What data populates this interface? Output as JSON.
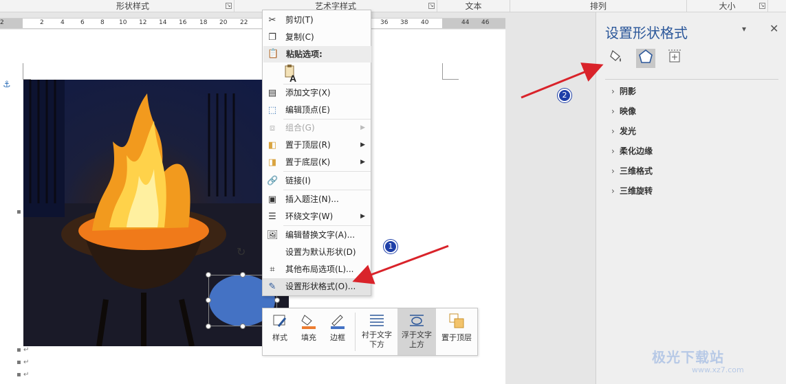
{
  "ribbon": {
    "groups": [
      {
        "label": "形状样式"
      },
      {
        "label": "艺术字样式"
      },
      {
        "label": "文本"
      },
      {
        "label": "排列"
      },
      {
        "label": "大小"
      }
    ]
  },
  "ruler": {
    "ticks": [
      "2",
      "2",
      "4",
      "6",
      "8",
      "10",
      "12",
      "14",
      "16",
      "18",
      "20",
      "22",
      "36",
      "38",
      "40",
      "44",
      "46"
    ]
  },
  "context_menu": {
    "items": [
      {
        "label": "剪切(T)",
        "icon": "scissors-icon"
      },
      {
        "label": "复制(C)",
        "icon": "copy-icon"
      },
      {
        "label": "粘贴选项:",
        "icon": "paste-icon"
      },
      {
        "label": "添加文字(X)",
        "icon": "add-text-icon"
      },
      {
        "label": "编辑顶点(E)",
        "icon": "edit-points-icon"
      },
      {
        "label": "组合(G)",
        "icon": "group-icon",
        "disabled": true
      },
      {
        "label": "置于顶层(R)",
        "icon": "bring-front-icon"
      },
      {
        "label": "置于底层(K)",
        "icon": "send-back-icon"
      },
      {
        "label": "链接(I)",
        "icon": "link-icon"
      },
      {
        "label": "插入题注(N)...",
        "icon": "caption-icon"
      },
      {
        "label": "环绕文字(W)",
        "icon": "wrap-text-icon"
      },
      {
        "label": "编辑替换文字(A)...",
        "icon": "alt-text-icon"
      },
      {
        "label": "设置为默认形状(D)",
        "icon": ""
      },
      {
        "label": "其他布局选项(L)...",
        "icon": "layout-icon"
      },
      {
        "label": "设置形状格式(O)...",
        "icon": "format-shape-icon"
      }
    ]
  },
  "mini_toolbar": {
    "style": "样式",
    "fill": "填充",
    "outline": "边框",
    "behind_line1": "衬于文字",
    "behind_line2": "下方",
    "front_line1": "浮于文字",
    "front_line2": "上方",
    "bring_front": "置于顶层"
  },
  "pane": {
    "title": "设置形状格式",
    "sections": [
      "阴影",
      "映像",
      "发光",
      "柔化边缘",
      "三维格式",
      "三维旋转"
    ]
  },
  "annotations": {
    "badge1": "1",
    "badge2": "2",
    "arrow_color": "#d9232a"
  },
  "watermark": {
    "text": "极光下载站",
    "url": "www.xz7.com"
  },
  "colors": {
    "shape_fill": "#4472c4",
    "pane_title": "#2b579a",
    "badge": "#1e3fa8"
  }
}
